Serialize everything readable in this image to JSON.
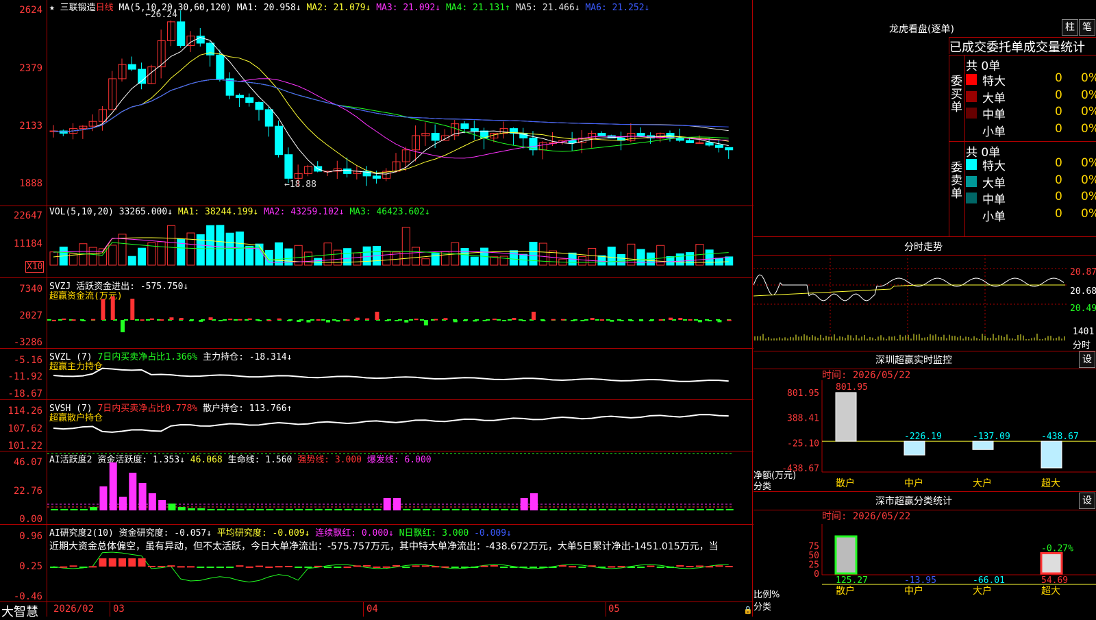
{
  "stock": {
    "name": "三联锻造",
    "period": "日线",
    "ma_label": "MA(5,10,20,30,60,120)"
  },
  "ma_values": [
    {
      "text": "MA1: 20.958↓",
      "color": "#ffffff"
    },
    {
      "text": "MA2: 21.079↓",
      "color": "#ffff33"
    },
    {
      "text": "MA3: 21.092↓",
      "color": "#ff33ff"
    },
    {
      "text": "MA4: 21.131↑",
      "color": "#22ff22"
    },
    {
      "text": "MA5: 21.466↓",
      "color": "#dddddd"
    },
    {
      "text": "MA6: 21.252↓",
      "color": "#3b5bff"
    }
  ],
  "price_axis": [
    "2624",
    "2379",
    "2133",
    "1888"
  ],
  "price_annotations": {
    "high": "26.24",
    "low": "18.88"
  },
  "vol": {
    "label": "VOL(5,10,20)",
    "value": "33265.000↓",
    "ma1": "MA1: 38244.199↓",
    "ma2": "MA2: 43259.102↓",
    "ma3": "MA3: 46423.602↓",
    "axis": [
      "22647",
      "11184"
    ],
    "unit": "X10"
  },
  "svzj": {
    "label": "SVZJ",
    "title": "活跃资金进出: -575.750↓",
    "subtitle": "超赢资金流(万元)",
    "axis": [
      "7340",
      "2027",
      "-3286"
    ]
  },
  "svzl": {
    "label": "SVZL (7)",
    "ratio": "7日内买卖净占比1.366%",
    "hold": "主力持仓: -18.314↓",
    "subtitle": "超赢主力持仓",
    "axis": [
      "-5.16",
      "-11.92",
      "-18.67"
    ]
  },
  "svsh": {
    "label": "SVSH (7)",
    "ratio": "7日内买卖净占比0.778%",
    "hold": "散户持仓: 113.766↑",
    "subtitle": "超赢散户持仓",
    "axis": [
      "114.26",
      "107.62",
      "101.22"
    ]
  },
  "ai_active": {
    "label": "AI活跃度2",
    "v1": "资金活跃度: 1.353↓",
    "v2": "46.068",
    "v3": "生命线: 1.560",
    "v4": "强势线: 3.000",
    "v5": "爆发线: 6.000",
    "axis": [
      "46.07",
      "22.76",
      "0.00"
    ]
  },
  "ai_research": {
    "label": "AI研究度2(10)",
    "v1": "资金研究度: -0.057↓",
    "v2": "平均研究度: -0.009↓",
    "v3": "连续飘红: 0.000↓",
    "v4": "N日飘红: 3.000",
    "v5": "-0.009↓",
    "comment": "近期大资金总体偏空，虽有异动，但不太活跃，今日大单净流出：-575.757万元，其中特大单净流出：-438.672万元，大单5日累计净出-1451.015万元，当",
    "axis": [
      "0.96",
      "0.25",
      "-0.46"
    ]
  },
  "bottom": {
    "brand": "大智慧",
    "dates": [
      "2026/02",
      "03",
      "04",
      "05"
    ]
  },
  "dragon": {
    "title": "龙虎看盘(逐单)",
    "btn1": "柱",
    "btn2": "笔",
    "header": "已成交委托单成交量统计",
    "buy": {
      "group": "委买单",
      "total": "共 0单",
      "rows": [
        {
          "label": "特大",
          "count": "0",
          "pct": "0%",
          "color": "#ff0000"
        },
        {
          "label": "大单",
          "count": "0",
          "pct": "0%",
          "color": "#990000"
        },
        {
          "label": "中单",
          "count": "0",
          "pct": "0%",
          "color": "#660000"
        },
        {
          "label": "小单",
          "count": "0",
          "pct": "0%",
          "color": "#000000"
        }
      ]
    },
    "sell": {
      "group": "委卖单",
      "total": "共 0单",
      "rows": [
        {
          "label": "特大",
          "count": "0",
          "pct": "0%",
          "color": "#00ffff"
        },
        {
          "label": "大单",
          "count": "0",
          "pct": "0%",
          "color": "#009999"
        },
        {
          "label": "中单",
          "count": "0",
          "pct": "0%",
          "color": "#006666"
        },
        {
          "label": "小单",
          "count": "0",
          "pct": "0%",
          "color": "#000000"
        }
      ]
    }
  },
  "intraday": {
    "title": "分时走势",
    "axis": [
      "20.87",
      "20.68",
      "20.49"
    ],
    "vol_label": "1401",
    "unit": "分时"
  },
  "monitor": {
    "title": "深圳超赢实时监控",
    "btn": "设",
    "time": "时间: 2026/05/22",
    "ylabel": "净额(万元)",
    "xlabel": "分类",
    "axis": [
      "801.95",
      "388.41",
      "-25.10",
      "-438.67"
    ],
    "chart_data": {
      "type": "bar",
      "categories": [
        "散户",
        "中户",
        "大户",
        "超大"
      ],
      "values": [
        801.95,
        -226.19,
        -137.09,
        -438.67
      ],
      "labels": [
        "801.95",
        "-226.19",
        "-137.09",
        "-438.67"
      ],
      "ylim": [
        -438.67,
        801.95
      ]
    }
  },
  "stats": {
    "title": "深市超赢分类统计",
    "btn": "设",
    "time": "时间: 2026/05/22",
    "ylabel": "比例%",
    "xlabel": "分类",
    "axis": [
      "75",
      "50",
      "25",
      "0"
    ],
    "chart_data": {
      "type": "bar",
      "categories": [
        "散户",
        "中户",
        "大户",
        "超大"
      ],
      "values": [
        125.27,
        -13.95,
        -66.01,
        54.69
      ],
      "labels": [
        "125.27",
        "-13.95",
        "-66.01",
        "54.69"
      ],
      "extra_label": "-0.27%"
    }
  }
}
